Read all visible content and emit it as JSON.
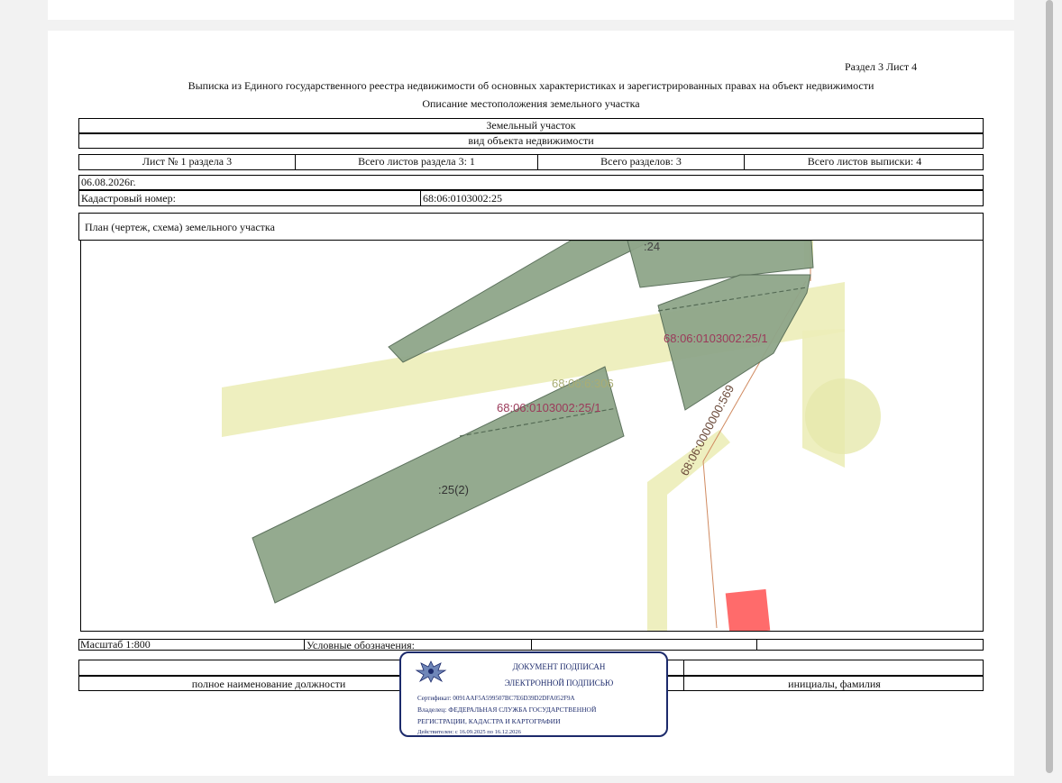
{
  "header": {
    "section_sheet": "Раздел 3    Лист 4",
    "title": "Выписка из Единого государственного реестра недвижимости об основных характеристиках и зарегистрированных правах на объект недвижимости",
    "subtitle": "Описание местоположения земельного участка"
  },
  "object": {
    "name": "Земельный участок",
    "kind_label": "вид объекта недвижимости"
  },
  "sheets": {
    "sheet_of_section": "Лист № 1 раздела 3",
    "total_sheets_section": "Всего листов раздела 3: 1",
    "total_sections": "Всего разделов: 3",
    "total_sheets_extract": "Всего листов выписки: 4"
  },
  "info": {
    "date": "06.08.2026г.",
    "cadastral_label": "Кадастровый номер:",
    "cadastral_value": "68:06:0103002:25"
  },
  "plan": {
    "title": "План (чертеж, схема) земельного участка",
    "labels": {
      "parcel_24": ":24",
      "parcel_25_1_top": "68:06:0103002:25/1",
      "parcel_neighbor": "68:06:6:306",
      "parcel_25_1_mid": "68:06:0103002:25/1",
      "parcel_25_2": ":25(2)",
      "road": "68:06:0000000:569"
    }
  },
  "footer": {
    "scale": "Масштаб 1:800",
    "legend": "Условные обозначения:",
    "position_label": "полное наименование должности",
    "initials_label": "инициалы, фамилия"
  },
  "stamp": {
    "line1": "ДОКУМЕНТ ПОДПИСАН",
    "line2": "ЭЛЕКТРОННОЙ ПОДПИСЬЮ",
    "certificate": "Сертификат: 0091AAF5A599507BC7E6D39D2DFA052F9A",
    "owner": "Владелец: ФЕДЕРАЛЬНАЯ СЛУЖБА ГОСУДАРСТВЕННОЙ",
    "owner2": "РЕГИСТРАЦИИ, КАДАСТРА И КАРТОГРАФИИ",
    "valid": "Действителен: с 16.09.2025 по 16.12.2026"
  },
  "colors": {
    "parcel_fill": "#8fa68a",
    "zone_fill": "#ecedb8",
    "label_red": "#9b3a5a",
    "stamp_blue": "#1c2a6b",
    "marker_red": "#ff6b6b"
  }
}
